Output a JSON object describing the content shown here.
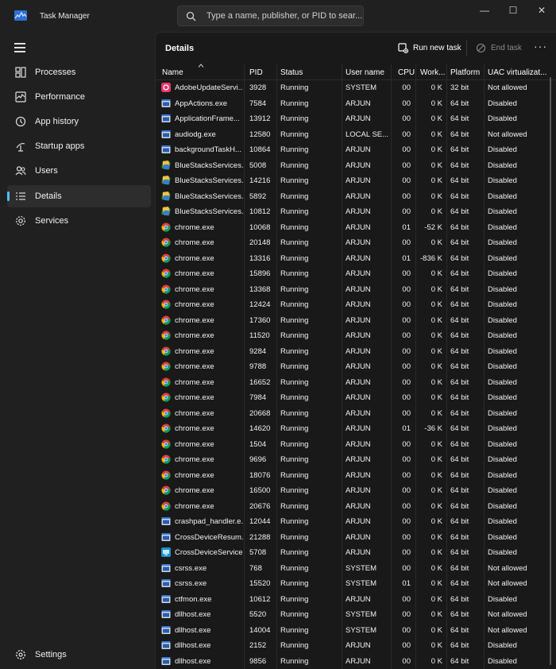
{
  "app": {
    "title": "Task Manager",
    "search_placeholder": "Type a name, publisher, or PID to sear..."
  },
  "window_controls": {
    "minimize": "—",
    "maximize": "☐",
    "close": "✕"
  },
  "sidebar": {
    "items": [
      {
        "label": "Processes",
        "icon": "processes-icon",
        "active": false
      },
      {
        "label": "Performance",
        "icon": "performance-icon",
        "active": false
      },
      {
        "label": "App history",
        "icon": "history-icon",
        "active": false
      },
      {
        "label": "Startup apps",
        "icon": "startup-icon",
        "active": false
      },
      {
        "label": "Users",
        "icon": "users-icon",
        "active": false
      },
      {
        "label": "Details",
        "icon": "details-icon",
        "active": true
      },
      {
        "label": "Services",
        "icon": "services-icon",
        "active": false
      }
    ],
    "settings_label": "Settings"
  },
  "main": {
    "title": "Details",
    "run_new_task": "Run new task",
    "end_task": "End task",
    "more": "···"
  },
  "table": {
    "columns": [
      "Name",
      "PID",
      "Status",
      "User name",
      "CPU",
      "Work...",
      "Platform",
      "UAC virtualizat..."
    ],
    "rows": [
      {
        "icon": "adobe",
        "name": "AdobeUpdateServi...",
        "pid": "3928",
        "status": "Running",
        "user": "SYSTEM",
        "cpu": "00",
        "mem": "0 K",
        "platform": "32 bit",
        "uac": "Not allowed"
      },
      {
        "icon": "app",
        "name": "AppActions.exe",
        "pid": "7584",
        "status": "Running",
        "user": "ARJUN",
        "cpu": "00",
        "mem": "0 K",
        "platform": "64 bit",
        "uac": "Disabled"
      },
      {
        "icon": "app",
        "name": "ApplicationFrame...",
        "pid": "13912",
        "status": "Running",
        "user": "ARJUN",
        "cpu": "00",
        "mem": "0 K",
        "platform": "64 bit",
        "uac": "Disabled"
      },
      {
        "icon": "app",
        "name": "audiodg.exe",
        "pid": "12580",
        "status": "Running",
        "user": "LOCAL SE...",
        "cpu": "00",
        "mem": "0 K",
        "platform": "64 bit",
        "uac": "Not allowed"
      },
      {
        "icon": "app",
        "name": "backgroundTaskH...",
        "pid": "10864",
        "status": "Running",
        "user": "ARJUN",
        "cpu": "00",
        "mem": "0 K",
        "platform": "64 bit",
        "uac": "Disabled"
      },
      {
        "icon": "bluestacks",
        "name": "BlueStacksServices...",
        "pid": "5008",
        "status": "Running",
        "user": "ARJUN",
        "cpu": "00",
        "mem": "0 K",
        "platform": "64 bit",
        "uac": "Disabled"
      },
      {
        "icon": "bluestacks",
        "name": "BlueStacksServices...",
        "pid": "14216",
        "status": "Running",
        "user": "ARJUN",
        "cpu": "00",
        "mem": "0 K",
        "platform": "64 bit",
        "uac": "Disabled"
      },
      {
        "icon": "bluestacks",
        "name": "BlueStacksServices...",
        "pid": "5892",
        "status": "Running",
        "user": "ARJUN",
        "cpu": "00",
        "mem": "0 K",
        "platform": "64 bit",
        "uac": "Disabled"
      },
      {
        "icon": "bluestacks",
        "name": "BlueStacksServices...",
        "pid": "10812",
        "status": "Running",
        "user": "ARJUN",
        "cpu": "00",
        "mem": "0 K",
        "platform": "64 bit",
        "uac": "Disabled"
      },
      {
        "icon": "chrome",
        "name": "chrome.exe",
        "pid": "10068",
        "status": "Running",
        "user": "ARJUN",
        "cpu": "01",
        "mem": "-52 K",
        "platform": "64 bit",
        "uac": "Disabled"
      },
      {
        "icon": "chrome",
        "name": "chrome.exe",
        "pid": "20148",
        "status": "Running",
        "user": "ARJUN",
        "cpu": "00",
        "mem": "0 K",
        "platform": "64 bit",
        "uac": "Disabled"
      },
      {
        "icon": "chrome",
        "name": "chrome.exe",
        "pid": "13316",
        "status": "Running",
        "user": "ARJUN",
        "cpu": "01",
        "mem": "-836 K",
        "platform": "64 bit",
        "uac": "Disabled"
      },
      {
        "icon": "chrome",
        "name": "chrome.exe",
        "pid": "15896",
        "status": "Running",
        "user": "ARJUN",
        "cpu": "00",
        "mem": "0 K",
        "platform": "64 bit",
        "uac": "Disabled"
      },
      {
        "icon": "chrome",
        "name": "chrome.exe",
        "pid": "13368",
        "status": "Running",
        "user": "ARJUN",
        "cpu": "00",
        "mem": "0 K",
        "platform": "64 bit",
        "uac": "Disabled"
      },
      {
        "icon": "chrome",
        "name": "chrome.exe",
        "pid": "12424",
        "status": "Running",
        "user": "ARJUN",
        "cpu": "00",
        "mem": "0 K",
        "platform": "64 bit",
        "uac": "Disabled"
      },
      {
        "icon": "chrome",
        "name": "chrome.exe",
        "pid": "17360",
        "status": "Running",
        "user": "ARJUN",
        "cpu": "00",
        "mem": "0 K",
        "platform": "64 bit",
        "uac": "Disabled"
      },
      {
        "icon": "chrome",
        "name": "chrome.exe",
        "pid": "11520",
        "status": "Running",
        "user": "ARJUN",
        "cpu": "00",
        "mem": "0 K",
        "platform": "64 bit",
        "uac": "Disabled"
      },
      {
        "icon": "chrome",
        "name": "chrome.exe",
        "pid": "9284",
        "status": "Running",
        "user": "ARJUN",
        "cpu": "00",
        "mem": "0 K",
        "platform": "64 bit",
        "uac": "Disabled"
      },
      {
        "icon": "chrome",
        "name": "chrome.exe",
        "pid": "9788",
        "status": "Running",
        "user": "ARJUN",
        "cpu": "00",
        "mem": "0 K",
        "platform": "64 bit",
        "uac": "Disabled"
      },
      {
        "icon": "chrome",
        "name": "chrome.exe",
        "pid": "16652",
        "status": "Running",
        "user": "ARJUN",
        "cpu": "00",
        "mem": "0 K",
        "platform": "64 bit",
        "uac": "Disabled"
      },
      {
        "icon": "chrome",
        "name": "chrome.exe",
        "pid": "7984",
        "status": "Running",
        "user": "ARJUN",
        "cpu": "00",
        "mem": "0 K",
        "platform": "64 bit",
        "uac": "Disabled"
      },
      {
        "icon": "chrome",
        "name": "chrome.exe",
        "pid": "20668",
        "status": "Running",
        "user": "ARJUN",
        "cpu": "00",
        "mem": "0 K",
        "platform": "64 bit",
        "uac": "Disabled"
      },
      {
        "icon": "chrome",
        "name": "chrome.exe",
        "pid": "14620",
        "status": "Running",
        "user": "ARJUN",
        "cpu": "01",
        "mem": "-36 K",
        "platform": "64 bit",
        "uac": "Disabled"
      },
      {
        "icon": "chrome",
        "name": "chrome.exe",
        "pid": "1504",
        "status": "Running",
        "user": "ARJUN",
        "cpu": "00",
        "mem": "0 K",
        "platform": "64 bit",
        "uac": "Disabled"
      },
      {
        "icon": "chrome",
        "name": "chrome.exe",
        "pid": "9696",
        "status": "Running",
        "user": "ARJUN",
        "cpu": "00",
        "mem": "0 K",
        "platform": "64 bit",
        "uac": "Disabled"
      },
      {
        "icon": "chrome",
        "name": "chrome.exe",
        "pid": "18076",
        "status": "Running",
        "user": "ARJUN",
        "cpu": "00",
        "mem": "0 K",
        "platform": "64 bit",
        "uac": "Disabled"
      },
      {
        "icon": "chrome",
        "name": "chrome.exe",
        "pid": "16500",
        "status": "Running",
        "user": "ARJUN",
        "cpu": "00",
        "mem": "0 K",
        "platform": "64 bit",
        "uac": "Disabled"
      },
      {
        "icon": "chrome",
        "name": "chrome.exe",
        "pid": "20676",
        "status": "Running",
        "user": "ARJUN",
        "cpu": "00",
        "mem": "0 K",
        "platform": "64 bit",
        "uac": "Disabled"
      },
      {
        "icon": "app",
        "name": "crashpad_handler.e...",
        "pid": "12044",
        "status": "Running",
        "user": "ARJUN",
        "cpu": "00",
        "mem": "0 K",
        "platform": "64 bit",
        "uac": "Disabled"
      },
      {
        "icon": "app",
        "name": "CrossDeviceResum...",
        "pid": "21288",
        "status": "Running",
        "user": "ARJUN",
        "cpu": "00",
        "mem": "0 K",
        "platform": "64 bit",
        "uac": "Disabled"
      },
      {
        "icon": "crossdevice",
        "name": "CrossDeviceService...",
        "pid": "5708",
        "status": "Running",
        "user": "ARJUN",
        "cpu": "00",
        "mem": "0 K",
        "platform": "64 bit",
        "uac": "Disabled"
      },
      {
        "icon": "app",
        "name": "csrss.exe",
        "pid": "768",
        "status": "Running",
        "user": "SYSTEM",
        "cpu": "00",
        "mem": "0 K",
        "platform": "64 bit",
        "uac": "Not allowed"
      },
      {
        "icon": "app",
        "name": "csrss.exe",
        "pid": "15520",
        "status": "Running",
        "user": "SYSTEM",
        "cpu": "01",
        "mem": "0 K",
        "platform": "64 bit",
        "uac": "Not allowed"
      },
      {
        "icon": "app",
        "name": "ctfmon.exe",
        "pid": "10612",
        "status": "Running",
        "user": "ARJUN",
        "cpu": "00",
        "mem": "0 K",
        "platform": "64 bit",
        "uac": "Disabled"
      },
      {
        "icon": "app",
        "name": "dllhost.exe",
        "pid": "5520",
        "status": "Running",
        "user": "SYSTEM",
        "cpu": "00",
        "mem": "0 K",
        "platform": "64 bit",
        "uac": "Not allowed"
      },
      {
        "icon": "app",
        "name": "dllhost.exe",
        "pid": "14004",
        "status": "Running",
        "user": "SYSTEM",
        "cpu": "00",
        "mem": "0 K",
        "platform": "64 bit",
        "uac": "Not allowed"
      },
      {
        "icon": "app",
        "name": "dllhost.exe",
        "pid": "2152",
        "status": "Running",
        "user": "ARJUN",
        "cpu": "00",
        "mem": "0 K",
        "platform": "64 bit",
        "uac": "Disabled"
      },
      {
        "icon": "app",
        "name": "dllhost.exe",
        "pid": "9856",
        "status": "Running",
        "user": "ARJUN",
        "cpu": "00",
        "mem": "0 K",
        "platform": "64 bit",
        "uac": "Disabled"
      }
    ]
  },
  "colors": {
    "accent": "#4cc2ff",
    "background": "#202020",
    "panel": "#191919"
  }
}
